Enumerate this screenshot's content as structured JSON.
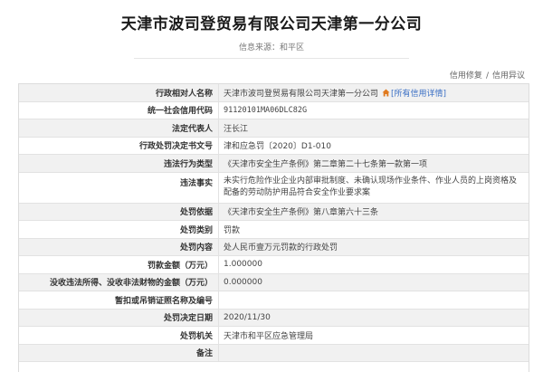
{
  "header": {
    "title": "天津市波司登贸易有限公司天津第一分公司",
    "source": "信息来源：和平区"
  },
  "actions": {
    "repair": "信用修复",
    "divider": "/",
    "objection": "信用异议"
  },
  "rows": [
    {
      "label": "行政相对人名称",
      "value": "天津市波司登贸易有限公司天津第一分公司",
      "link": "[所有信用详情]"
    },
    {
      "label": "统一社会信用代码",
      "value": "91120101MA06DLC82G"
    },
    {
      "label": "法定代表人",
      "value": "汪长江"
    },
    {
      "label": "行政处罚决定书文号",
      "value": "津和应急罚〔2020〕D1-010"
    },
    {
      "label": "违法行为类型",
      "value": "《天津市安全生产条例》第二章第二十七条第一款第一项"
    },
    {
      "label": "违法事实",
      "value": "未实行危险作业企业内部审批制度、未确认现场作业条件、作业人员的上岗资格及配备的劳动防护用品符合安全作业要求案"
    },
    {
      "label": "处罚依据",
      "value": "《天津市安全生产条例》第八章第六十三条"
    },
    {
      "label": "处罚类别",
      "value": "罚款"
    },
    {
      "label": "处罚内容",
      "value": "处人民币壹万元罚款的行政处罚"
    },
    {
      "label": "罚款金额（万元）",
      "value": "1.000000"
    },
    {
      "label": "没收违法所得、没收非法财物的金额（万元）",
      "value": "0.000000"
    },
    {
      "label": "暂扣或吊销证照名称及编号",
      "value": ""
    },
    {
      "label": "处罚决定日期",
      "value": "2020/11/30"
    },
    {
      "label": "处罚机关",
      "value": "天津市和平区应急管理局"
    },
    {
      "label": "备注",
      "value": ""
    }
  ],
  "colors": {
    "link": "#3a6fc4",
    "home_icon": "#e07a1f",
    "row_alt": "#f1f1f1"
  },
  "icons": {
    "home": "home-icon"
  }
}
